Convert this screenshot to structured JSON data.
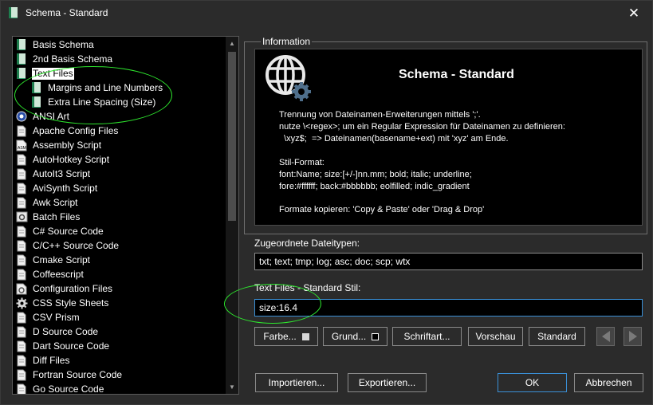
{
  "window": {
    "title": "Schema - Standard",
    "close_glyph": "✕"
  },
  "schema_list": {
    "items": [
      {
        "label": "Basis Schema",
        "icon": "schema-book-icon",
        "child": false,
        "selected": false
      },
      {
        "label": "2nd Basis Schema",
        "icon": "schema-book-icon",
        "child": false,
        "selected": false
      },
      {
        "label": "Text Files",
        "icon": "schema-book-icon",
        "child": false,
        "selected": true
      },
      {
        "label": "Margins and Line Numbers",
        "icon": "schema-book-icon",
        "child": true,
        "selected": false
      },
      {
        "label": "Extra Line Spacing (Size)",
        "icon": "schema-book-icon",
        "child": true,
        "selected": false
      },
      {
        "label": "ANSI Art",
        "icon": "ansi-art-icon",
        "child": false,
        "selected": false
      },
      {
        "label": "Apache Config Files",
        "icon": "document-icon",
        "child": false,
        "selected": false
      },
      {
        "label": "Assembly Script",
        "icon": "asm-file-icon",
        "child": false,
        "selected": false
      },
      {
        "label": "AutoHotkey Script",
        "icon": "document-icon",
        "child": false,
        "selected": false
      },
      {
        "label": "AutoIt3 Script",
        "icon": "document-icon",
        "child": false,
        "selected": false
      },
      {
        "label": "AviSynth Script",
        "icon": "document-icon",
        "child": false,
        "selected": false
      },
      {
        "label": "Awk Script",
        "icon": "document-icon",
        "child": false,
        "selected": false
      },
      {
        "label": "Batch Files",
        "icon": "gear-window-icon",
        "child": false,
        "selected": false
      },
      {
        "label": "C# Source Code",
        "icon": "document-icon",
        "child": false,
        "selected": false
      },
      {
        "label": "C/C++ Source Code",
        "icon": "document-icon",
        "child": false,
        "selected": false
      },
      {
        "label": "Cmake Script",
        "icon": "document-icon",
        "child": false,
        "selected": false
      },
      {
        "label": "Coffeescript",
        "icon": "document-icon",
        "child": false,
        "selected": false
      },
      {
        "label": "Configuration Files",
        "icon": "config-gear-icon",
        "child": false,
        "selected": false
      },
      {
        "label": "CSS Style Sheets",
        "icon": "gear-icon",
        "child": false,
        "selected": false
      },
      {
        "label": "CSV Prism",
        "icon": "document-icon",
        "child": false,
        "selected": false
      },
      {
        "label": "D Source Code",
        "icon": "document-icon",
        "child": false,
        "selected": false
      },
      {
        "label": "Dart Source Code",
        "icon": "document-icon",
        "child": false,
        "selected": false
      },
      {
        "label": "Diff Files",
        "icon": "document-icon",
        "child": false,
        "selected": false
      },
      {
        "label": "Fortran Source Code",
        "icon": "document-icon",
        "child": false,
        "selected": false
      },
      {
        "label": "Go Source Code",
        "icon": "document-icon",
        "child": false,
        "selected": false
      }
    ]
  },
  "information": {
    "group_title": "Information",
    "title": "Schema - Standard",
    "icon": "globe-gear-icon",
    "lines": [
      "Trennung von Dateinamen-Erweiterungen mittels ';'.",
      "nutze \\<regex>; um ein Regular Expression für Dateinamen zu definieren:",
      "  \\xyz$;  => Dateinamen(basename+ext) mit 'xyz' am Ende.",
      "Stil-Format:",
      "font:Name; size:[+/-]nn.mm; bold; italic; underline;",
      "fore:#ffffff; back:#bbbbbb; eolfilled; indic_gradient",
      "Formate kopieren: 'Copy & Paste' oder 'Drag & Drop'"
    ]
  },
  "file_types": {
    "label": "Zugeordnete Dateitypen:",
    "value": "txt; text; tmp; log; asc; doc; scp; wtx"
  },
  "style": {
    "label": "Text Files - Standard Stil:",
    "value": "size:16.4"
  },
  "style_buttons": {
    "color": "Farbe...",
    "ground": "Grund...",
    "font": "Schriftart...",
    "preview": "Vorschau",
    "standard": "Standard",
    "color_swatch": "#d8d8d8",
    "ground_swatch": "#000000"
  },
  "footer_buttons": {
    "import": "Importieren...",
    "export": "Exportieren...",
    "ok": "OK",
    "cancel": "Abbrechen"
  },
  "colors": {
    "background": "#2b2b2b",
    "panel": "#000000",
    "accent": "#3a8fd6",
    "annotation": "#2ee82e"
  }
}
